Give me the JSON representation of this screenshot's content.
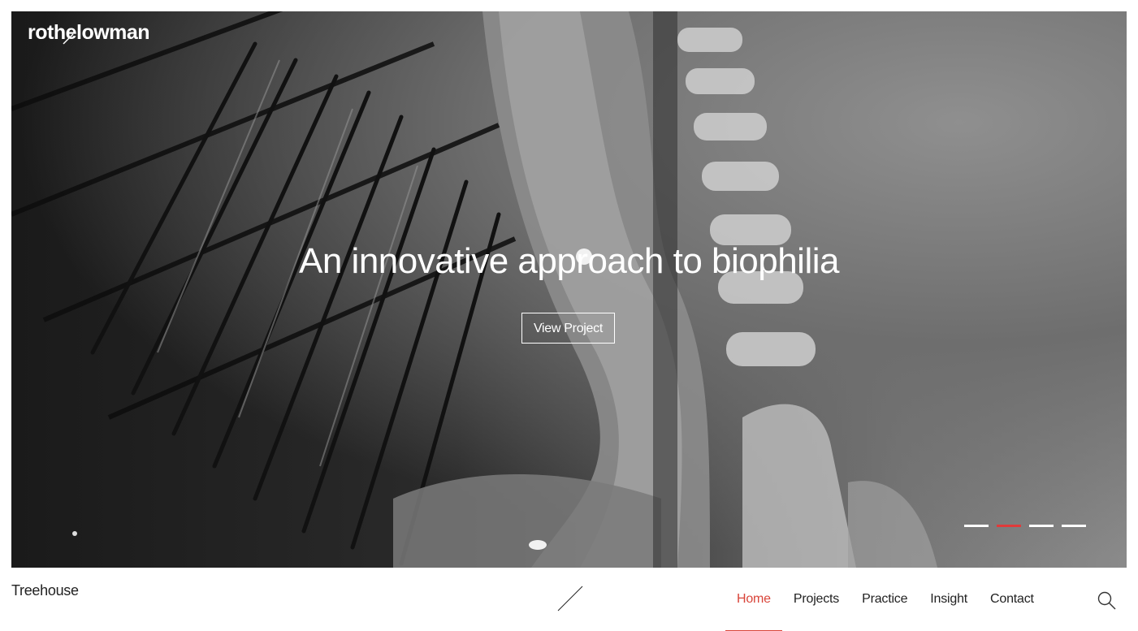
{
  "brand": {
    "name": "rothelowman"
  },
  "hero": {
    "headline": "An innovative approach to biophilia",
    "cta_label": "View Project",
    "slides": [
      {
        "active": false
      },
      {
        "active": true
      },
      {
        "active": false
      },
      {
        "active": false
      }
    ]
  },
  "footer": {
    "project_name": "Treehouse",
    "nav": [
      {
        "label": "Home",
        "active": true
      },
      {
        "label": "Projects",
        "active": false
      },
      {
        "label": "Practice",
        "active": false
      },
      {
        "label": "Insight",
        "active": false
      },
      {
        "label": "Contact",
        "active": false
      }
    ]
  },
  "colors": {
    "accent": "#d9453a",
    "slide_active": "#e03a3a",
    "text": "#222222"
  },
  "icons": {
    "search": "search-icon",
    "divider": "slash-divider-icon"
  }
}
